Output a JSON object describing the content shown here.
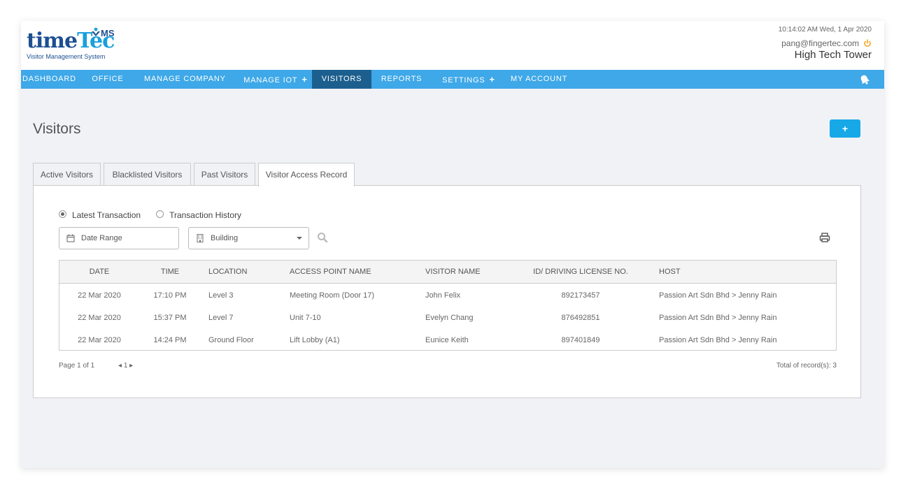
{
  "header": {
    "logo_time": "time",
    "logo_tec": "Tec",
    "logo_vms": "MS",
    "logo_subtitle": "Visitor Management System",
    "datetime": "10:14:02 AM  Wed, 1 Apr 2020",
    "user_email": "pang@fingertec.com",
    "building": "High Tech Tower"
  },
  "nav": {
    "items": [
      {
        "label": "DASHBOARD"
      },
      {
        "label": "OFFICE"
      },
      {
        "label": "MANAGE COMPANY"
      },
      {
        "label": "MANAGE IOT",
        "plus": "+"
      },
      {
        "label": "VISITORS"
      },
      {
        "label": "REPORTS"
      },
      {
        "label": "SETTINGS",
        "plus": "+"
      },
      {
        "label": "MY ACCOUNT"
      }
    ],
    "active": "VISITORS"
  },
  "page": {
    "title": "Visitors",
    "add_label": "+"
  },
  "tabs": [
    {
      "label": "Active Visitors"
    },
    {
      "label": "Blacklisted Visitors"
    },
    {
      "label": "Past Visitors"
    },
    {
      "label": "Visitor Access Record"
    }
  ],
  "filters": {
    "radio_latest": "Latest Transaction",
    "radio_history": "Transaction History",
    "date_placeholder": "Date Range",
    "building_placeholder": "Building"
  },
  "table": {
    "columns": [
      "DATE",
      "TIME",
      "LOCATION",
      "ACCESS POINT NAME",
      "VISITOR NAME",
      "ID/ DRIVING LICENSE NO.",
      "HOST"
    ],
    "rows": [
      [
        "22 Mar 2020",
        "17:10 PM",
        "Level 3",
        "Meeting Room (Door 17)",
        "John Felix",
        "892173457",
        "Passion Art Sdn Bhd > Jenny Rain"
      ],
      [
        "22 Mar 2020",
        "15:37 PM",
        "Level 7",
        "Unit 7-10",
        "Evelyn Chang",
        "876492851",
        "Passion Art Sdn Bhd > Jenny Rain"
      ],
      [
        "22 Mar 2020",
        "14:24 PM",
        "Ground Floor",
        "Lift Lobby (A1)",
        "Eunice Keith",
        "897401849",
        "Passion Art Sdn Bhd > Jenny Rain"
      ]
    ]
  },
  "pagination": {
    "page_text": "Page 1 of 1",
    "prev": "◂",
    "current": "1",
    "next": "▸",
    "total": "Total of record(s): 3"
  },
  "colors": {
    "nav_bg": "#3ea8e8",
    "nav_active": "#1c5f8e",
    "add_button": "#17a8e8",
    "logo_dark": "#1d4f91",
    "logo_light": "#1aa0db",
    "power": "#f5a623"
  },
  "icons": [
    "calendar-icon",
    "building-icon",
    "search-icon",
    "print-icon",
    "bell-icon",
    "power-icon"
  ]
}
